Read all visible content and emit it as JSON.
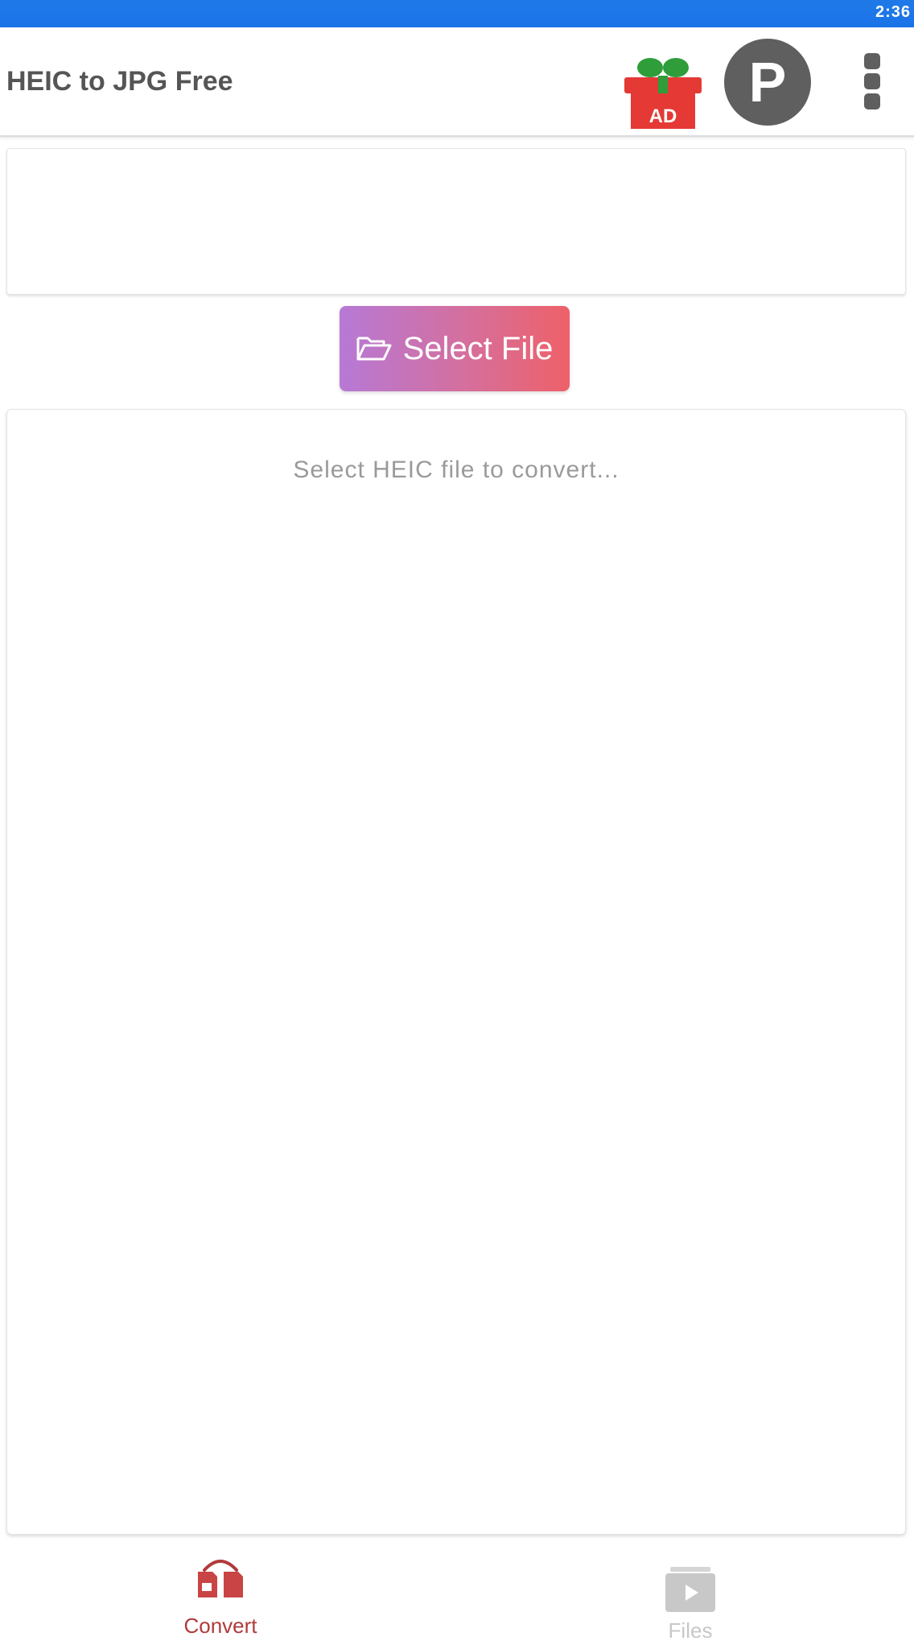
{
  "status_bar": {
    "time": "2:36"
  },
  "app_bar": {
    "title": "HEIC to JPG Free",
    "gift_badge": "AD",
    "premium_letter": "P",
    "icons": {
      "gift": "gift-ad-icon",
      "premium": "premium-icon",
      "more": "more-vert-icon"
    }
  },
  "main": {
    "select_button_label": "Select File",
    "select_button_icon": "folder-open-icon",
    "placeholder": "Select HEIC file to convert..."
  },
  "bottom_nav": {
    "tabs": [
      {
        "label": "Convert",
        "icon": "convert-icon",
        "active": true
      },
      {
        "label": "Files",
        "icon": "files-icon",
        "active": false
      }
    ]
  },
  "colors": {
    "status_bar": "#1a73e8",
    "button_gradient_start": "#b679d6",
    "button_gradient_end": "#ee6168",
    "active_tab": "#b03a3a",
    "inactive_tab": "#c8c8c8"
  }
}
